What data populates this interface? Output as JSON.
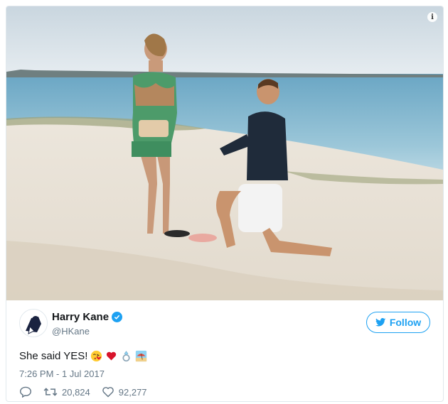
{
  "tweet": {
    "author": {
      "display_name": "Harry Kane",
      "handle": "@HKane",
      "verified": true
    },
    "follow_label": "Follow",
    "text": "She said YES!",
    "emoji": [
      "face-blowing-kiss",
      "red-heart",
      "ring",
      "beach-with-umbrella"
    ],
    "timestamp": "7:26 PM - 1 Jul 2017",
    "retweets": "20,824",
    "likes": "92,277"
  },
  "colors": {
    "accent": "#1da1f2",
    "muted": "#657786",
    "text": "#14171a",
    "border": "#e1e8ed"
  },
  "icons": [
    "info-icon",
    "verified-badge-icon",
    "twitter-bird-icon",
    "reply-icon",
    "retweet-icon",
    "heart-icon"
  ]
}
